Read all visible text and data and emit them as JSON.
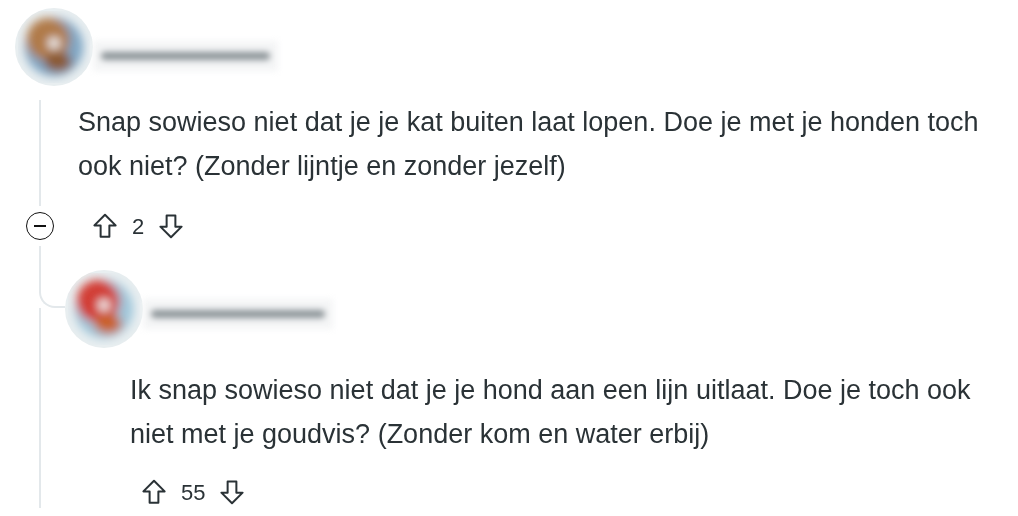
{
  "comments": [
    {
      "body": "Snap sowieso niet dat je je kat buiten laat lopen. Doe je met je honden toch ook niet? (Zonder lijntje en zonder jezelf)",
      "score": "2",
      "collapsible": true,
      "children": [
        {
          "body": "Ik snap sowieso niet dat je je hond aan een lijn uitlaat. Doe je toch ook niet met je goudvis? (Zonder kom en water erbij)",
          "score": "55"
        }
      ]
    }
  ]
}
